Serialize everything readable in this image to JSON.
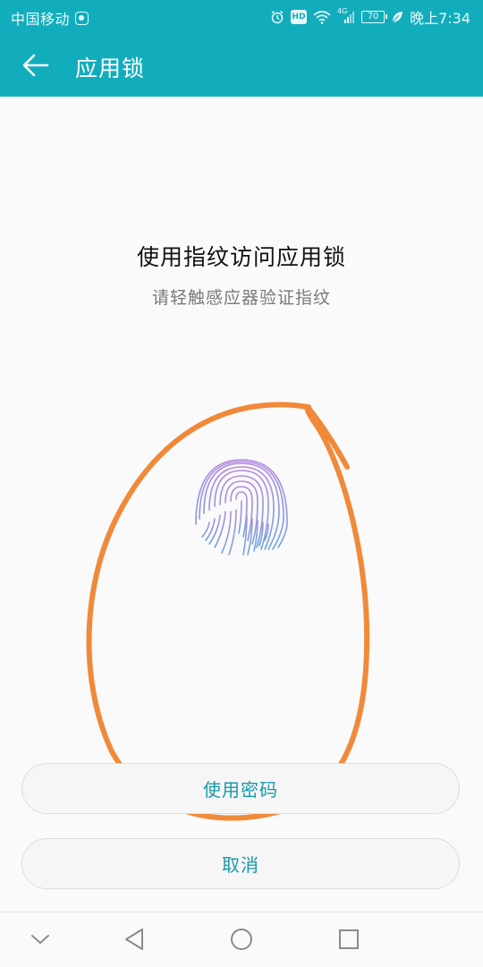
{
  "status_bar": {
    "carrier": "中国移动",
    "network": "4G",
    "battery": "70",
    "time": "晚上7:34",
    "hd_label": "HD",
    "icons": [
      "carrier-app-icon",
      "alarm-icon",
      "hd-icon",
      "wifi-icon",
      "signal-icon",
      "battery-icon",
      "leaf-icon"
    ]
  },
  "app_bar": {
    "title": "应用锁",
    "back_icon": "back-arrow-icon"
  },
  "prompt": {
    "title": "使用指纹访问应用锁",
    "subtitle": "请轻触感应器验证指纹",
    "icon": "fingerprint-icon"
  },
  "buttons": {
    "use_password": "使用密码",
    "cancel": "取消"
  },
  "nav": {
    "icons": [
      "collapse-chevron-icon",
      "back-triangle-icon",
      "home-circle-icon",
      "recents-square-icon"
    ]
  },
  "colors": {
    "accent": "#12adbd",
    "button_text": "#159aa8",
    "annotation": "#f08a3a",
    "fingerprint_top": "#b48be0",
    "fingerprint_bottom": "#6ea3e0"
  }
}
